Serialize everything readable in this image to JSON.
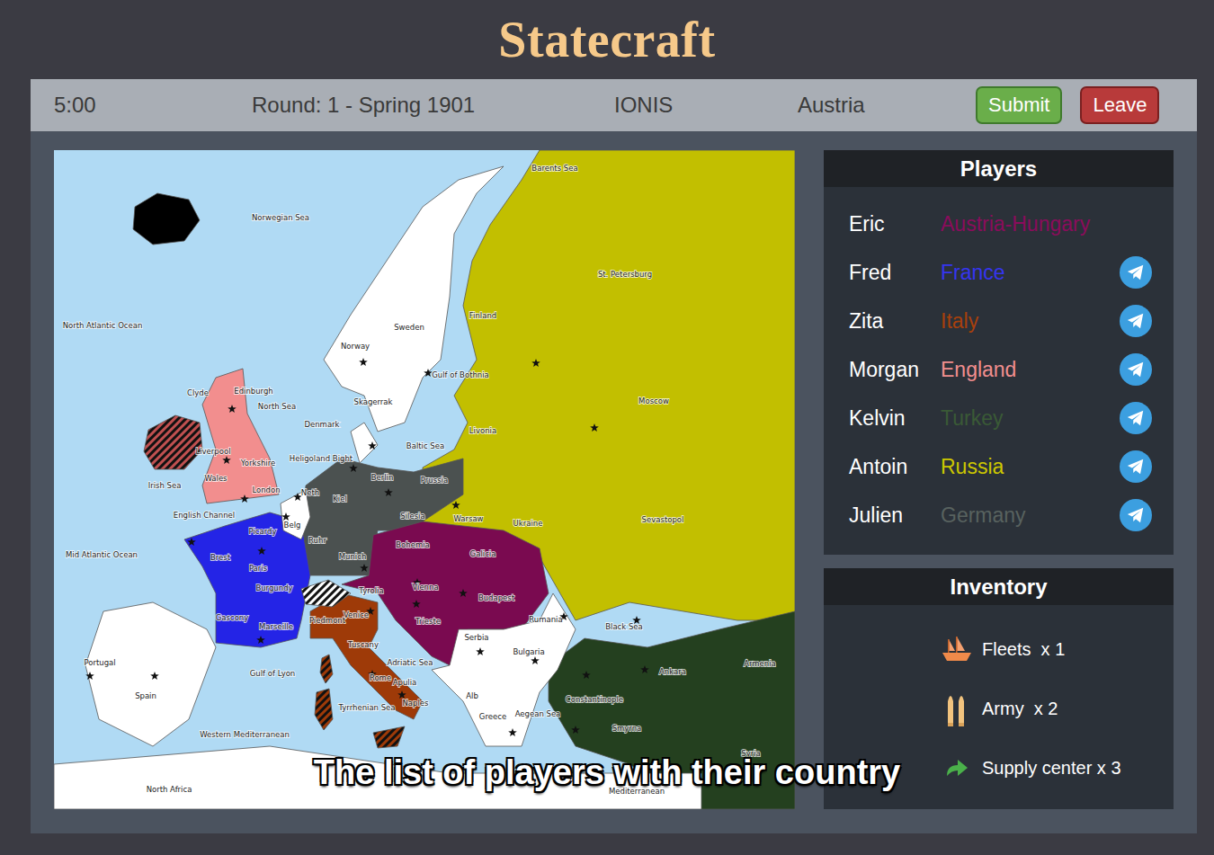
{
  "app": {
    "title": "Statecraft"
  },
  "top_bar": {
    "timer": "5:00",
    "round": "Round: 1 - Spring 1901",
    "game": "IONIS",
    "country": "Austria",
    "buttons": [
      {
        "label": "Submit",
        "kind": "submit"
      },
      {
        "label": "Leave",
        "kind": "leave"
      }
    ]
  },
  "players": {
    "title": "Players",
    "items": [
      {
        "name": "Eric",
        "country": "Austria-Hungary",
        "color": "#8a0c5c",
        "message": false
      },
      {
        "name": "Fred",
        "country": "France",
        "color": "#3535f0",
        "message": true
      },
      {
        "name": "Zita",
        "country": "Italy",
        "color": "#a8400c",
        "message": true
      },
      {
        "name": "Morgan",
        "country": "England",
        "color": "#f28e8e",
        "message": true
      },
      {
        "name": "Kelvin",
        "country": "Turkey",
        "color": "#3a5a36",
        "message": true
      },
      {
        "name": "Antoin",
        "country": "Russia",
        "color": "#cdc800",
        "message": true
      },
      {
        "name": "Julien",
        "country": "Germany",
        "color": "#58625f",
        "message": true
      }
    ]
  },
  "inventory": {
    "title": "Inventory",
    "items": [
      {
        "label": "Fleets  x 1",
        "kind": "fleet"
      },
      {
        "label": "Army  x 2",
        "kind": "army"
      },
      {
        "label": "Supply center x 3",
        "kind": "supply"
      }
    ]
  },
  "map": {
    "territories": [
      {
        "color": "#c2bf00",
        "kind": "solid"
      },
      {
        "color": "#ffffff",
        "kind": "solid"
      },
      {
        "color": "#4b5150",
        "kind": "solid"
      },
      {
        "color": "#7a0a50",
        "kind": "solid"
      },
      {
        "color": "#2424e6",
        "kind": "solid"
      },
      {
        "color": "#9e3a08",
        "kind": "solid"
      },
      {
        "color": "#f28e8e",
        "kind": "solid"
      },
      {
        "color": "#24401f",
        "kind": "solid"
      },
      {
        "color": "#ffffff",
        "kind": "solid"
      },
      {
        "color": "#ffffff",
        "kind": "solid"
      },
      {
        "color": "#ffffff",
        "kind": "solid"
      },
      {
        "color": "#ffffff",
        "kind": "solid"
      },
      {
        "color": "#ffffff",
        "kind": "solid"
      },
      {
        "color": "#000000",
        "kind": "solid"
      },
      {
        "color": "#c05050",
        "kind": "hatched"
      },
      {
        "color": "#ffffff",
        "kind": "hatched"
      },
      {
        "color": "#9e3a08",
        "kind": "hatched"
      },
      {
        "color": "#9e3a08",
        "kind": "hatched"
      },
      {
        "color": "#9e3a08",
        "kind": "hatched"
      }
    ],
    "labels": [
      "Barents Sea",
      "Norwegian Sea",
      "North Atlantic Ocean",
      "St. Petersburg",
      "Finland",
      "Sweden",
      "Norway",
      "Gulf of Bothnia",
      "Moscow",
      "Clyde",
      "Edinburgh",
      "North Sea",
      "Skagerrak",
      "Denmark",
      "Livonia",
      "Baltic Sea",
      "Liverpool",
      "Yorkshire",
      "Heligoland Bight",
      "Berlin",
      "Prussia",
      "Kiel",
      "Irish Sea",
      "Wales",
      "London",
      "English Channel",
      "Silesia",
      "Warsaw",
      "Ukraine",
      "Sevastopol",
      "Mid Atlantic Ocean",
      "Picardy",
      "Brest",
      "Paris",
      "Ruhr",
      "Bohemia",
      "Galicia",
      "Munich",
      "Burgundy",
      "Tyrolia",
      "Vienna",
      "Budapest",
      "Gascony",
      "Piedmont",
      "Venice",
      "Marseille",
      "Trieste",
      "Rumania",
      "Black Sea",
      "Portugal",
      "Gulf of Lyon",
      "Tuscany",
      "Serbia",
      "Adriatic Sea",
      "Bulgaria",
      "Ankara",
      "Armenia",
      "Rome",
      "Apulia",
      "Spain",
      "Constantinople",
      "Tyrrhenian Sea",
      "Naples",
      "Alb",
      "Aegean Sea",
      "Greece",
      "Smyrna",
      "Western Mediterranean",
      "Syria",
      "North Africa",
      "Mediterranean",
      "Belg",
      "Neth"
    ]
  },
  "caption": "The list of players with their country"
}
